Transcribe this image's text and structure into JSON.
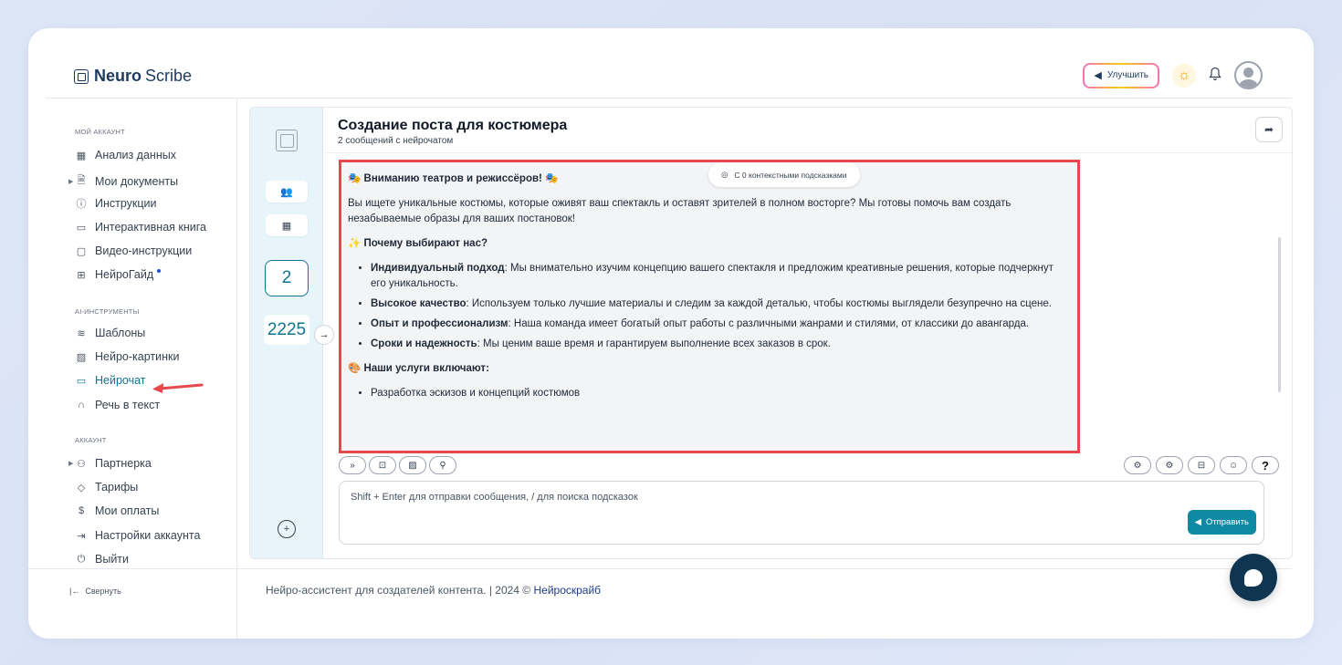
{
  "logo": {
    "bold": "Neuro",
    "regular": "Scribe"
  },
  "header": {
    "upgrade_label": "Улучшить"
  },
  "sidebar": {
    "section_account": "МОЙ АККАУНТ",
    "account_items": [
      {
        "label": "Анализ данных",
        "icon": "grid-icon"
      },
      {
        "label": "Мои документы",
        "icon": "document-icon"
      },
      {
        "label": "Инструкции",
        "icon": "help-circle-icon"
      },
      {
        "label": "Интерактивная книга",
        "icon": "book-icon"
      },
      {
        "label": "Видео-инструкции",
        "icon": "video-icon"
      },
      {
        "label": "НейроГайд",
        "icon": "layout-icon"
      }
    ],
    "section_ai": "AI-ИНСТРУМЕНТЫ",
    "ai_items": [
      {
        "label": "Шаблоны",
        "icon": "layers-icon"
      },
      {
        "label": "Нейро-картинки",
        "icon": "image-icon"
      },
      {
        "label": "Нейрочат",
        "icon": "chat-icon"
      },
      {
        "label": "Речь в текст",
        "icon": "headphones-icon"
      }
    ],
    "section_acc2": "АККАУНТ",
    "acc_items": [
      {
        "label": "Партнерка",
        "icon": "users-icon"
      },
      {
        "label": "Тарифы",
        "icon": "tag-icon"
      },
      {
        "label": "Мои оплаты",
        "icon": "dollar-icon"
      },
      {
        "label": "Настройки аккаунта",
        "icon": "login-icon"
      },
      {
        "label": "Выйти",
        "icon": "power-icon"
      }
    ],
    "collapse_label": "Свернуть"
  },
  "rail": {
    "counter": "2",
    "tokens": "2225"
  },
  "chat": {
    "title": "Создание поста для костюмера",
    "subtitle": "2 сообщений с нейрочатом",
    "context_hint": "С 0 контекстными подсказками",
    "message": {
      "heading1": "🎭 Вниманию театров и режиссёров! 🎭",
      "intro": "Вы ищете уникальные костюмы, которые оживят ваш спектакль и оставят зрителей в полном восторге? Мы готовы помочь вам создать незабываемые образы для ваших постановок!",
      "heading2": "✨ Почему выбирают нас?",
      "bullets": [
        {
          "bold": "Индивидуальный подход",
          "text": ": Мы внимательно изучим концепцию вашего спектакля и предложим креативные решения, которые подчеркнут его уникальность."
        },
        {
          "bold": "Высокое качество",
          "text": ": Используем только лучшие материалы и следим за каждой деталью, чтобы костюмы выглядели безупречно на сцене."
        },
        {
          "bold": "Опыт и профессионализм",
          "text": ": Наша команда имеет богатый опыт работы с различными жанрами и стилями, от классики до авангарда."
        },
        {
          "bold": "Сроки и надежность",
          "text": ": Мы ценим ваше время и гарантируем выполнение всех заказов в срок."
        }
      ],
      "heading3": "🎨 Наши услуги включают:",
      "services": [
        "Разработка эскизов и концепций костюмов"
      ]
    },
    "input_placeholder": "Shift + Enter для отправки сообщения, / для поиска подсказок",
    "send_label": "Отправить"
  },
  "footer": {
    "text": "Нейро-ассистент для создателей контента.  | 2024 © ",
    "link": "Нейроскрайб"
  }
}
